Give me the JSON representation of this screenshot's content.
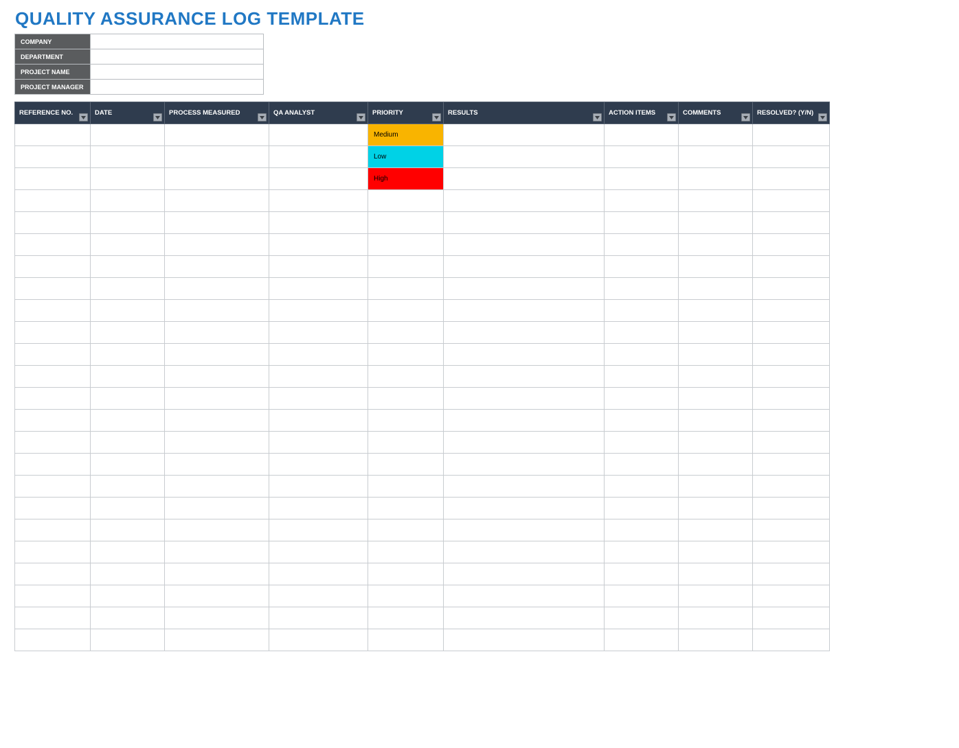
{
  "title": "QUALITY ASSURANCE LOG TEMPLATE",
  "meta": {
    "labels": {
      "company": "COMPANY",
      "department": "DEPARTMENT",
      "project_name": "PROJECT NAME",
      "project_manager": "PROJECT MANAGER"
    },
    "values": {
      "company": "",
      "department": "",
      "project_name": "",
      "project_manager": ""
    }
  },
  "columns": [
    {
      "key": "reference_no",
      "label": "REFERENCE NO."
    },
    {
      "key": "date",
      "label": "DATE"
    },
    {
      "key": "process_measured",
      "label": "PROCESS MEASURED"
    },
    {
      "key": "qa_analyst",
      "label": "QA ANALYST"
    },
    {
      "key": "priority",
      "label": "PRIORITY"
    },
    {
      "key": "results",
      "label": "RESULTS"
    },
    {
      "key": "action_items",
      "label": "ACTION ITEMS"
    },
    {
      "key": "comments",
      "label": "COMMENTS"
    },
    {
      "key": "resolved",
      "label": "RESOLVED? (Y/N)"
    }
  ],
  "priority_colors": {
    "Medium": "#f9b400",
    "Low": "#00d2e6",
    "High": "#ff0000"
  },
  "rows": [
    {
      "reference_no": "",
      "date": "",
      "process_measured": "",
      "qa_analyst": "",
      "priority": "Medium",
      "results": "",
      "action_items": "",
      "comments": "",
      "resolved": ""
    },
    {
      "reference_no": "",
      "date": "",
      "process_measured": "",
      "qa_analyst": "",
      "priority": "Low",
      "results": "",
      "action_items": "",
      "comments": "",
      "resolved": ""
    },
    {
      "reference_no": "",
      "date": "",
      "process_measured": "",
      "qa_analyst": "",
      "priority": "High",
      "results": "",
      "action_items": "",
      "comments": "",
      "resolved": ""
    },
    {
      "reference_no": "",
      "date": "",
      "process_measured": "",
      "qa_analyst": "",
      "priority": "",
      "results": "",
      "action_items": "",
      "comments": "",
      "resolved": ""
    },
    {
      "reference_no": "",
      "date": "",
      "process_measured": "",
      "qa_analyst": "",
      "priority": "",
      "results": "",
      "action_items": "",
      "comments": "",
      "resolved": ""
    },
    {
      "reference_no": "",
      "date": "",
      "process_measured": "",
      "qa_analyst": "",
      "priority": "",
      "results": "",
      "action_items": "",
      "comments": "",
      "resolved": ""
    },
    {
      "reference_no": "",
      "date": "",
      "process_measured": "",
      "qa_analyst": "",
      "priority": "",
      "results": "",
      "action_items": "",
      "comments": "",
      "resolved": ""
    },
    {
      "reference_no": "",
      "date": "",
      "process_measured": "",
      "qa_analyst": "",
      "priority": "",
      "results": "",
      "action_items": "",
      "comments": "",
      "resolved": ""
    },
    {
      "reference_no": "",
      "date": "",
      "process_measured": "",
      "qa_analyst": "",
      "priority": "",
      "results": "",
      "action_items": "",
      "comments": "",
      "resolved": ""
    },
    {
      "reference_no": "",
      "date": "",
      "process_measured": "",
      "qa_analyst": "",
      "priority": "",
      "results": "",
      "action_items": "",
      "comments": "",
      "resolved": ""
    },
    {
      "reference_no": "",
      "date": "",
      "process_measured": "",
      "qa_analyst": "",
      "priority": "",
      "results": "",
      "action_items": "",
      "comments": "",
      "resolved": ""
    },
    {
      "reference_no": "",
      "date": "",
      "process_measured": "",
      "qa_analyst": "",
      "priority": "",
      "results": "",
      "action_items": "",
      "comments": "",
      "resolved": ""
    },
    {
      "reference_no": "",
      "date": "",
      "process_measured": "",
      "qa_analyst": "",
      "priority": "",
      "results": "",
      "action_items": "",
      "comments": "",
      "resolved": ""
    },
    {
      "reference_no": "",
      "date": "",
      "process_measured": "",
      "qa_analyst": "",
      "priority": "",
      "results": "",
      "action_items": "",
      "comments": "",
      "resolved": ""
    },
    {
      "reference_no": "",
      "date": "",
      "process_measured": "",
      "qa_analyst": "",
      "priority": "",
      "results": "",
      "action_items": "",
      "comments": "",
      "resolved": ""
    },
    {
      "reference_no": "",
      "date": "",
      "process_measured": "",
      "qa_analyst": "",
      "priority": "",
      "results": "",
      "action_items": "",
      "comments": "",
      "resolved": ""
    },
    {
      "reference_no": "",
      "date": "",
      "process_measured": "",
      "qa_analyst": "",
      "priority": "",
      "results": "",
      "action_items": "",
      "comments": "",
      "resolved": ""
    },
    {
      "reference_no": "",
      "date": "",
      "process_measured": "",
      "qa_analyst": "",
      "priority": "",
      "results": "",
      "action_items": "",
      "comments": "",
      "resolved": ""
    },
    {
      "reference_no": "",
      "date": "",
      "process_measured": "",
      "qa_analyst": "",
      "priority": "",
      "results": "",
      "action_items": "",
      "comments": "",
      "resolved": ""
    },
    {
      "reference_no": "",
      "date": "",
      "process_measured": "",
      "qa_analyst": "",
      "priority": "",
      "results": "",
      "action_items": "",
      "comments": "",
      "resolved": ""
    },
    {
      "reference_no": "",
      "date": "",
      "process_measured": "",
      "qa_analyst": "",
      "priority": "",
      "results": "",
      "action_items": "",
      "comments": "",
      "resolved": ""
    },
    {
      "reference_no": "",
      "date": "",
      "process_measured": "",
      "qa_analyst": "",
      "priority": "",
      "results": "",
      "action_items": "",
      "comments": "",
      "resolved": ""
    },
    {
      "reference_no": "",
      "date": "",
      "process_measured": "",
      "qa_analyst": "",
      "priority": "",
      "results": "",
      "action_items": "",
      "comments": "",
      "resolved": ""
    },
    {
      "reference_no": "",
      "date": "",
      "process_measured": "",
      "qa_analyst": "",
      "priority": "",
      "results": "",
      "action_items": "",
      "comments": "",
      "resolved": ""
    }
  ]
}
